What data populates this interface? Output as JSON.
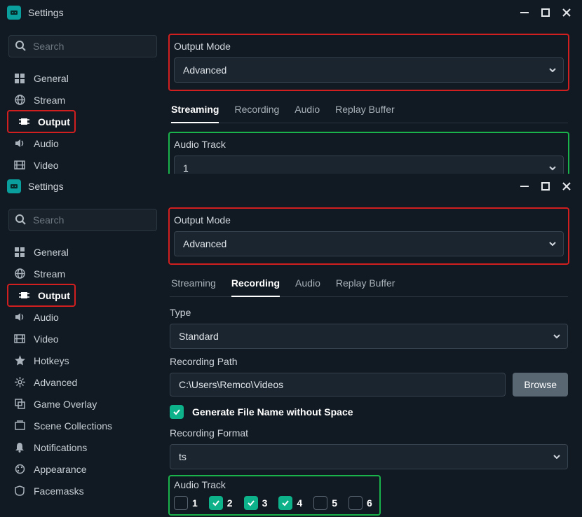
{
  "window_title": "Settings",
  "search_placeholder": "Search",
  "sidebar_short": [
    {
      "icon": "grid",
      "label": "General"
    },
    {
      "icon": "globe",
      "label": "Stream"
    },
    {
      "icon": "chip",
      "label": "Output",
      "active": true
    },
    {
      "icon": "volume",
      "label": "Audio"
    },
    {
      "icon": "film",
      "label": "Video"
    }
  ],
  "sidebar_long": [
    {
      "icon": "grid",
      "label": "General"
    },
    {
      "icon": "globe",
      "label": "Stream"
    },
    {
      "icon": "chip",
      "label": "Output",
      "active": true
    },
    {
      "icon": "volume",
      "label": "Audio"
    },
    {
      "icon": "film",
      "label": "Video"
    },
    {
      "icon": "star",
      "label": "Hotkeys"
    },
    {
      "icon": "gear",
      "label": "Advanced"
    },
    {
      "icon": "overlay",
      "label": "Game Overlay"
    },
    {
      "icon": "scene",
      "label": "Scene Collections"
    },
    {
      "icon": "bell",
      "label": "Notifications"
    },
    {
      "icon": "appearance",
      "label": "Appearance"
    },
    {
      "icon": "mask",
      "label": "Facemasks"
    }
  ],
  "top": {
    "output_mode_label": "Output Mode",
    "output_mode_value": "Advanced",
    "tabs": [
      "Streaming",
      "Recording",
      "Audio",
      "Replay Buffer"
    ],
    "active_tab": "Streaming",
    "audio_track_label": "Audio Track",
    "audio_track_value": "1"
  },
  "bottom": {
    "output_mode_label": "Output Mode",
    "output_mode_value": "Advanced",
    "tabs": [
      "Streaming",
      "Recording",
      "Audio",
      "Replay Buffer"
    ],
    "active_tab": "Recording",
    "type_label": "Type",
    "type_value": "Standard",
    "recording_path_label": "Recording Path",
    "recording_path_value": "C:\\Users\\Remco\\Videos",
    "browse_label": "Browse",
    "gen_filename_label": "Generate File Name without Space",
    "gen_filename_checked": true,
    "recording_format_label": "Recording Format",
    "recording_format_value": "ts",
    "audio_track_label": "Audio Track",
    "audio_tracks": [
      {
        "n": "1",
        "checked": false
      },
      {
        "n": "2",
        "checked": true
      },
      {
        "n": "3",
        "checked": true
      },
      {
        "n": "4",
        "checked": true
      },
      {
        "n": "5",
        "checked": false
      },
      {
        "n": "6",
        "checked": false
      }
    ]
  }
}
